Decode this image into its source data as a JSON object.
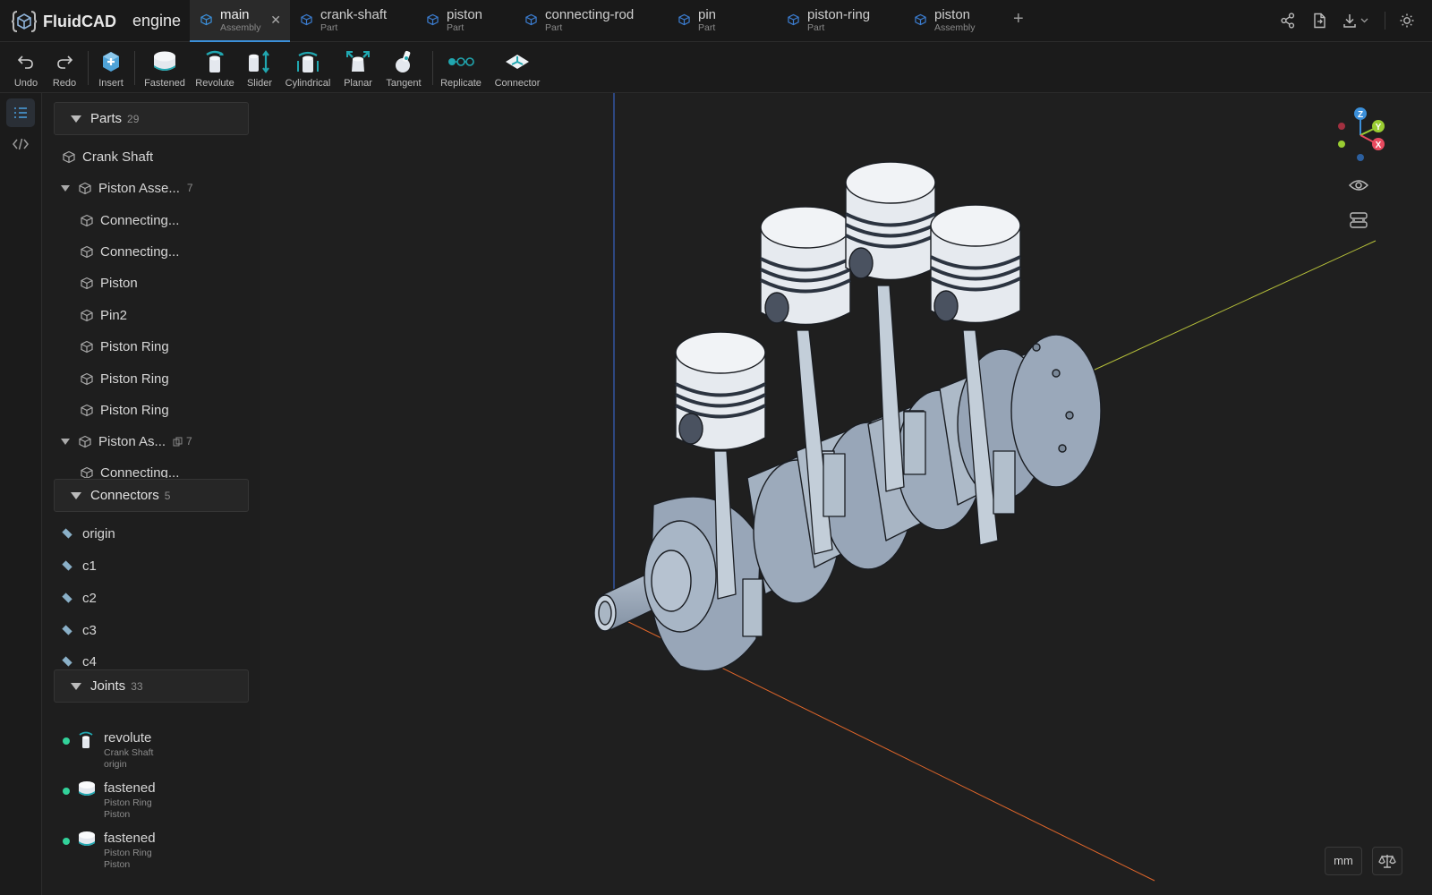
{
  "app": {
    "name": "FluidCAD",
    "project": "engine"
  },
  "tabs": [
    {
      "name": "main",
      "type": "Assembly",
      "active": true
    },
    {
      "name": "crank-shaft",
      "type": "Part"
    },
    {
      "name": "piston",
      "type": "Part"
    },
    {
      "name": "connecting-rod",
      "type": "Part"
    },
    {
      "name": "pin",
      "type": "Part"
    },
    {
      "name": "piston-ring",
      "type": "Part"
    },
    {
      "name": "piston",
      "type": "Assembly"
    }
  ],
  "top_right_icons": [
    "share-icon",
    "export-file-icon",
    "download-icon",
    "theme-icon"
  ],
  "toolbar": {
    "undo": "Undo",
    "redo": "Redo",
    "insert": "Insert",
    "fastened": "Fastened",
    "revolute": "Revolute",
    "slider": "Slider",
    "cylindrical": "Cylindrical",
    "planar": "Planar",
    "tangent": "Tangent",
    "replicate": "Replicate",
    "connector": "Connector"
  },
  "parts": {
    "title": "Parts",
    "count": "29",
    "items": [
      {
        "label": "Crank Shaft"
      },
      {
        "label": "Piston Asse...",
        "count": "7"
      },
      {
        "label": "Connecting..."
      },
      {
        "label": "Connecting..."
      },
      {
        "label": "Piston"
      },
      {
        "label": "Pin2"
      },
      {
        "label": "Piston Ring"
      },
      {
        "label": "Piston Ring"
      },
      {
        "label": "Piston Ring"
      },
      {
        "label": "Piston As...",
        "count": "7"
      },
      {
        "label": "Connecting..."
      }
    ]
  },
  "connectors": {
    "title": "Connectors",
    "count": "5",
    "items": [
      "origin",
      "c1",
      "c2",
      "c3",
      "c4"
    ]
  },
  "joints": {
    "title": "Joints",
    "count": "33",
    "items": [
      {
        "name": "revolute",
        "sub1": "Crank Shaft",
        "sub2": "origin"
      },
      {
        "name": "fastened",
        "sub1": "Piston Ring",
        "sub2": "Piston"
      },
      {
        "name": "fastened",
        "sub1": "Piston Ring",
        "sub2": "Piston"
      }
    ]
  },
  "viewport": {
    "unit": "mm",
    "gizmo_axes": [
      "Z",
      "Y",
      "X"
    ]
  },
  "colors": {
    "accent": "#3b8fd9",
    "teal": "#21a7b0",
    "joint_ok": "#32d29a",
    "part_fill": "#a8b6c6",
    "axis_x": "#e0662a",
    "axis_y": "#c8d23a",
    "axis_z": "#3b6fe0"
  }
}
